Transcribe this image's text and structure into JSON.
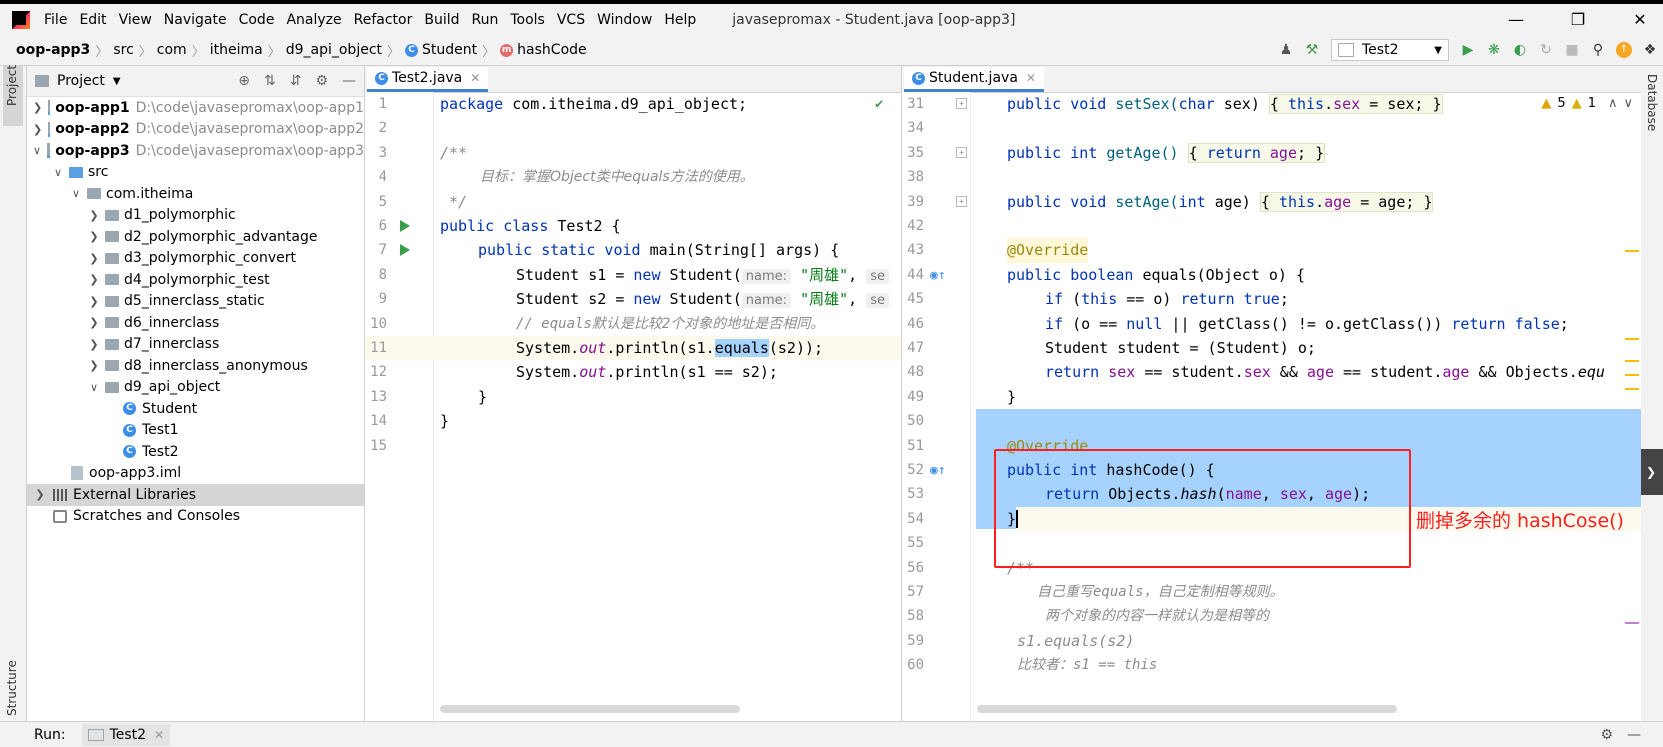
{
  "menu": {
    "items": [
      "File",
      "Edit",
      "View",
      "Navigate",
      "Code",
      "Analyze",
      "Refactor",
      "Build",
      "Run",
      "Tools",
      "VCS",
      "Window",
      "Help"
    ],
    "window_title": "javasepromax - Student.java [oop-app3]"
  },
  "breadcrumb": [
    "oop-app3",
    "src",
    "com",
    "itheima",
    "d9_api_object",
    "Student",
    "hashCode"
  ],
  "toolbar": {
    "run_config": "Test2"
  },
  "project_panel": {
    "title": "Project",
    "tree": [
      {
        "label": "oop-app1",
        "path": "D:\\code\\javasepromax\\oop-app1"
      },
      {
        "label": "oop-app2",
        "path": "D:\\code\\javasepromax\\oop-app2"
      },
      {
        "label": "oop-app3",
        "path": "D:\\code\\javasepromax\\oop-app3"
      },
      {
        "label": "src"
      },
      {
        "label": "com.itheima"
      },
      {
        "label": "d1_polymorphic"
      },
      {
        "label": "d2_polymorphic_advantage"
      },
      {
        "label": "d3_polymorphic_convert"
      },
      {
        "label": "d4_polymorphic_test"
      },
      {
        "label": "d5_innerclass_static"
      },
      {
        "label": "d6_innerclass"
      },
      {
        "label": "d7_innerclass"
      },
      {
        "label": "d8_innerclass_anonymous"
      },
      {
        "label": "d9_api_object"
      },
      {
        "label": "Student"
      },
      {
        "label": "Test1"
      },
      {
        "label": "Test2"
      },
      {
        "label": "oop-app3.iml"
      },
      {
        "label": "External Libraries"
      },
      {
        "label": "Scratches and Consoles"
      }
    ]
  },
  "stripes": {
    "left_top": "Project",
    "left_bottom": "Structure",
    "right": "Database"
  },
  "editor_left": {
    "tab": "Test2.java",
    "lines": [
      {
        "n": "1"
      },
      {
        "n": "2"
      },
      {
        "n": "3"
      },
      {
        "n": "4"
      },
      {
        "n": "5"
      },
      {
        "n": "6"
      },
      {
        "n": "7"
      },
      {
        "n": "8"
      },
      {
        "n": "9"
      },
      {
        "n": "10"
      },
      {
        "n": "11"
      },
      {
        "n": "12"
      },
      {
        "n": "13"
      },
      {
        "n": "14"
      },
      {
        "n": "15"
      }
    ],
    "code": {
      "l1_kw": "package",
      "l1_rest": " com.itheima.d9_api_object;",
      "l3": "/**",
      "l4": "目标：掌握Object类中equals方法的使用。",
      "l5": " */",
      "l6_kw": "public class",
      "l6_rest": " Test2 {",
      "l7_kw": "public static void",
      "l7_rest": " main(String[] args) {",
      "l8_a": "Student s1 = ",
      "l8_kw": "new",
      "l8_b": " Student(",
      "l8_hint": "name:",
      "l8_str": "\"周雄\"",
      "l8_c": ",",
      "l8_hint2": "se",
      "l9_a": "Student s2 = ",
      "l9_kw": "new",
      "l9_b": " Student(",
      "l9_hint": "name:",
      "l9_str": "\"周雄\"",
      "l9_c": ",",
      "l9_hint2": "se",
      "l10": "// equals默认是比较2个对象的地址是否相同。",
      "l11_a": "System.",
      "l11_out": "out",
      "l11_b": ".println(s1.",
      "l11_sel": "equals",
      "l11_c": "(s2));",
      "l12_a": "System.",
      "l12_out": "out",
      "l12_b": ".println(s1 == s2);",
      "l13": "}",
      "l14": "}"
    }
  },
  "editor_right": {
    "tab": "Student.java",
    "warnings": "5",
    "weak_warnings": "1",
    "lines": [
      "31",
      "34",
      "35",
      "38",
      "39",
      "42",
      "43",
      "44",
      "45",
      "46",
      "47",
      "48",
      "49",
      "50",
      "51",
      "52",
      "53",
      "54",
      "55",
      "56",
      "57",
      "58",
      "59",
      "60"
    ],
    "code": {
      "l31_kw": "public void",
      "l31_m": " setSex(",
      "l31_kw2": "char",
      "l31_a": " sex) ",
      "l31_b": "{ ",
      "l31_kw3": "this",
      "l31_c": ".",
      "l31_f": "sex",
      "l31_d": " = sex; ",
      "l31_e": "}",
      "l35_kw": "public int",
      "l35_m": " getAge() ",
      "l35_b": "{ ",
      "l35_kw2": "return",
      "l35_f": " age",
      "l35_d": "; ",
      "l35_e": "}",
      "l39_kw": "public void",
      "l39_m": " setAge(",
      "l39_kw2": "int",
      "l39_a": " age) ",
      "l39_b": "{ ",
      "l39_kw3": "this",
      "l39_c": ".",
      "l39_f": "age",
      "l39_d": " = age; ",
      "l39_e": "}",
      "l43": "@Override",
      "l44_kw": "public boolean",
      "l44_rest": " equals(Object o) {",
      "l45_kw": "if",
      "l45_a": " (",
      "l45_kw2": "this",
      "l45_b": " == o) ",
      "l45_kw3": "return true",
      "l45_c": ";",
      "l46_kw": "if",
      "l46_a": " (o == ",
      "l46_kw2": "null",
      "l46_b": " || getClass() != o.getClass()) ",
      "l46_kw3": "return false",
      "l46_c": ";",
      "l47": "Student student = (Student) o;",
      "l48_kw": "return",
      "l48_f1": " sex",
      "l48_a": " == student.",
      "l48_f2": "sex",
      "l48_b": " && ",
      "l48_f3": "age",
      "l48_c": " == student.",
      "l48_f4": "age",
      "l48_d": " && Objects.",
      "l48_e": "equ",
      "l49": "}",
      "l51": "@Override",
      "l52_kw": "public int",
      "l52_rest": " hashCode() {",
      "l53_kw": "return",
      "l53_a": " Objects.",
      "l53_m": "hash",
      "l53_b": "(",
      "l53_f1": "name",
      "l53_c": ", ",
      "l53_f2": "sex",
      "l53_d": ", ",
      "l53_f3": "age",
      "l53_e": ");",
      "l54": "}",
      "l56": "/**",
      "l57": "自己重写equals，自己定制相等规则。",
      "l58": "两个对象的内容一样就认为是相等的",
      "l59": "s1.equals(s2)",
      "l60": "比较者：s1 == this"
    }
  },
  "annotation": {
    "note": "删掉多余的 hashCose()"
  },
  "runbar": {
    "label": "Run:",
    "tab": "Test2"
  }
}
